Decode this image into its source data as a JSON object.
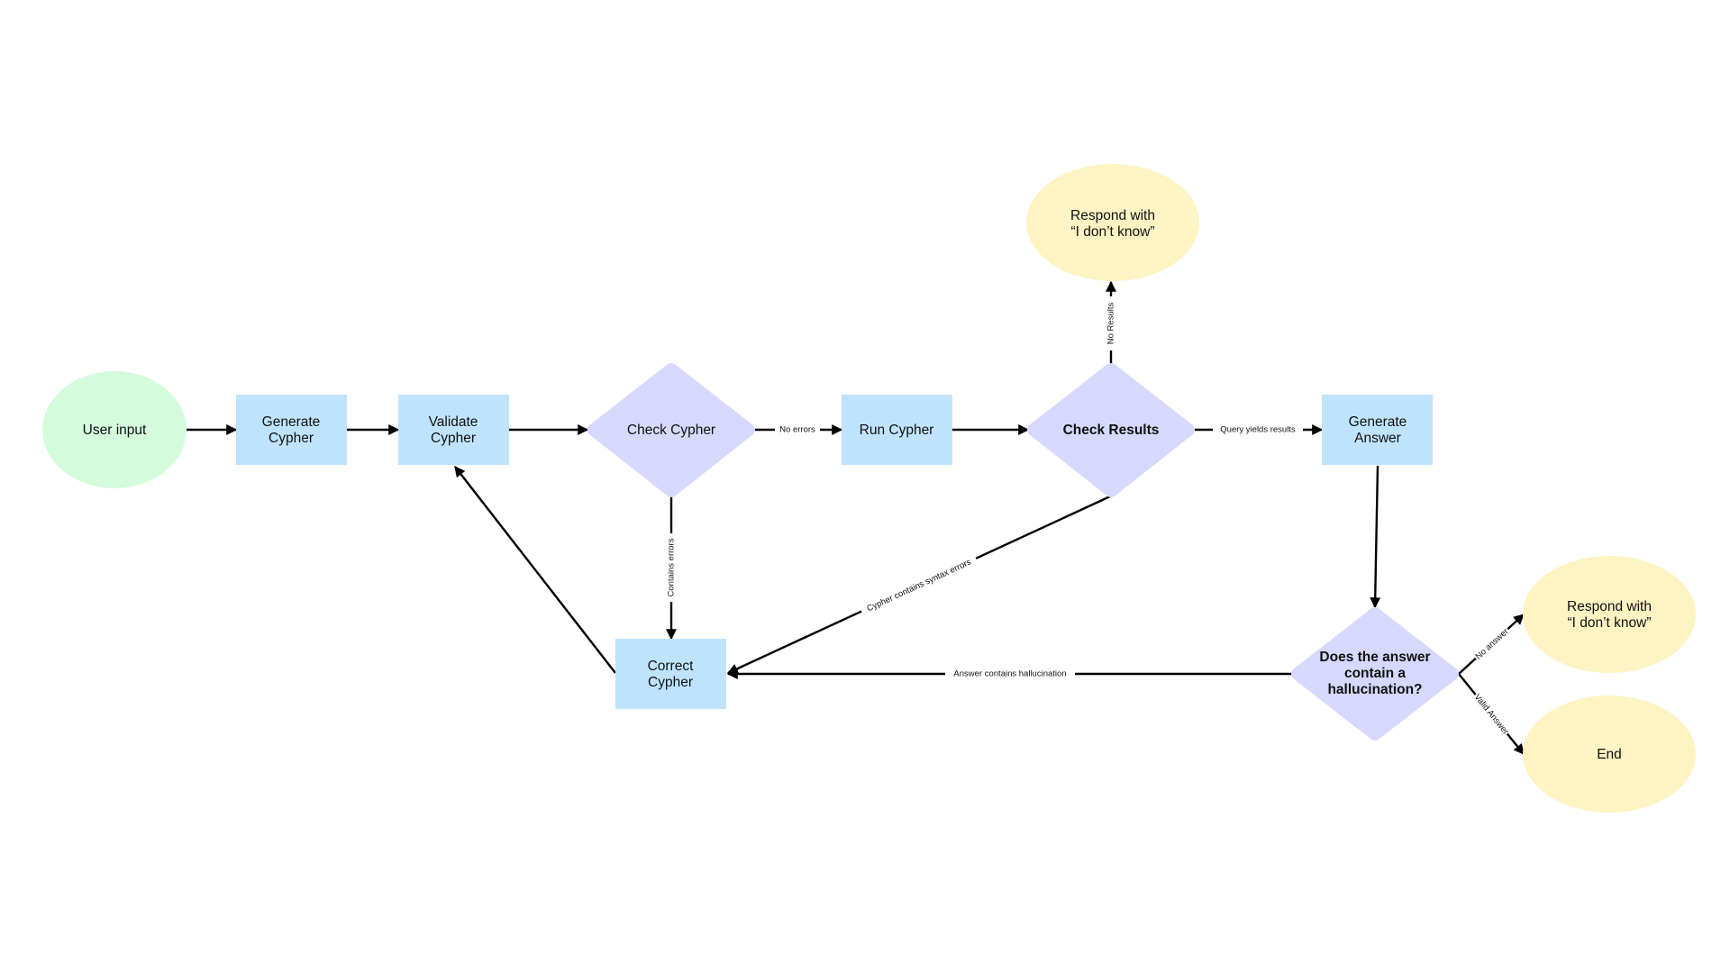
{
  "colors": {
    "start": "#d4fbdc",
    "process": "#bfe3fd",
    "decision": "#d6d8fd",
    "terminal": "#fef3c2",
    "edge": "#000000"
  },
  "nodes": {
    "user_input": {
      "lines": [
        "User input"
      ]
    },
    "generate_cypher": {
      "lines": [
        "Generate",
        "Cypher"
      ]
    },
    "validate_cypher": {
      "lines": [
        "Validate",
        "Cypher"
      ]
    },
    "check_cypher": {
      "lines": [
        "Check Cypher"
      ]
    },
    "run_cypher": {
      "lines": [
        "Run Cypher"
      ]
    },
    "check_results": {
      "lines": [
        "Check Results"
      ]
    },
    "generate_answer": {
      "lines": [
        "Generate",
        "Answer"
      ]
    },
    "respond_top": {
      "lines": [
        "Respond with",
        "“I don’t know”"
      ]
    },
    "correct_cypher": {
      "lines": [
        "Correct",
        "Cypher"
      ]
    },
    "hallucination_check": {
      "lines": [
        "Does the answer",
        "contain a",
        "hallucination?"
      ]
    },
    "respond_right": {
      "lines": [
        "Respond with",
        "“I don’t know”"
      ]
    },
    "end": {
      "lines": [
        "End"
      ]
    }
  },
  "edges": {
    "no_errors": "No errors",
    "contains_errors": "Contains errors",
    "no_results": "No Results",
    "query_yields_results": "Query yields results",
    "syntax_errors": "Cypher contains syntax errors",
    "hallucination": "Answer contains hallucination",
    "no_answer": "No answer",
    "valid_answer": "Valid Answer"
  }
}
